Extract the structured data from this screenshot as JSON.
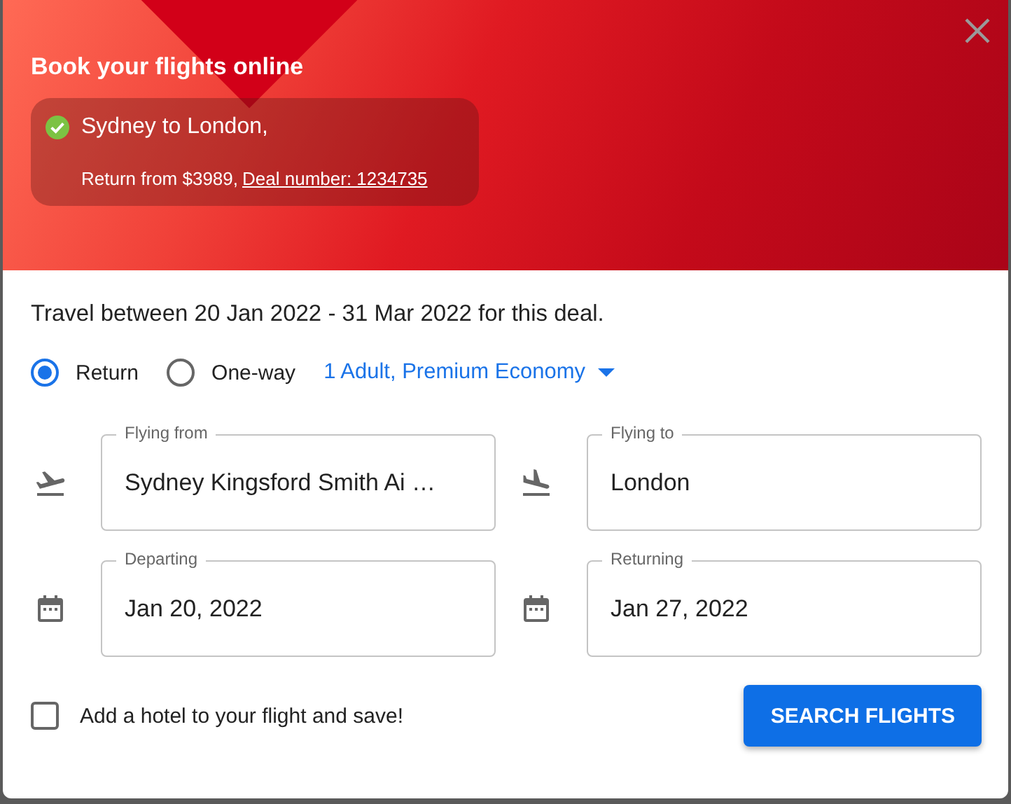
{
  "header": {
    "title": "Book your flights online",
    "deal": {
      "route": "Sydney to London,",
      "price": "Return from $3989,",
      "link": "Deal number: 1234735"
    }
  },
  "travel_note": "Travel between 20 Jan 2022 - 31 Mar 2022 for this deal.",
  "trip_types": [
    {
      "label": "Return",
      "selected": true
    },
    {
      "label": "One-way",
      "selected": false
    }
  ],
  "passengers": "1 Adult, Premium Economy",
  "fields": [
    {
      "kind": "departure",
      "label": "Flying from",
      "value": "Sydney Kingsford Smith Ai …"
    },
    {
      "kind": "arrival",
      "label": "Flying to",
      "value": "London"
    },
    {
      "kind": "date",
      "label": "Departing",
      "value": "Jan 20, 2022"
    },
    {
      "kind": "date",
      "label": "Returning",
      "value": "Jan 27, 2022"
    }
  ],
  "hotel_option": {
    "label": "Add a hotel to your flight and save!",
    "checked": false
  },
  "search_button": "SEARCH FLIGHTS"
}
